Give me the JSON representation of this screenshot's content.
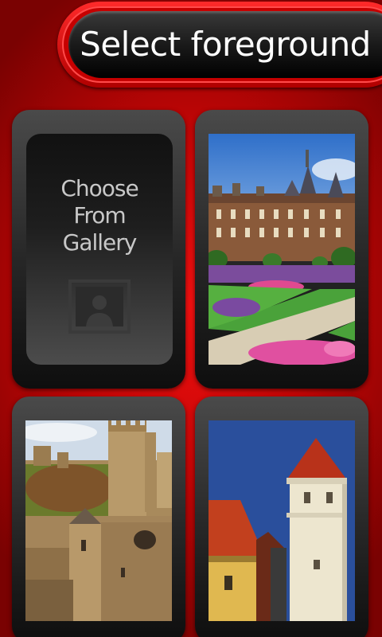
{
  "header": {
    "title": "Select foreground"
  },
  "gallery": {
    "label_line1": "Choose",
    "label_line2": "From",
    "label_line3": "Gallery",
    "icon": "person-picture-icon"
  },
  "thumbnails": [
    {
      "name": "manor-garden"
    },
    {
      "name": "castle-walls"
    },
    {
      "name": "tower-rooftops"
    }
  ],
  "colors": {
    "background": "#c80606",
    "header_bg": "#1a1a1a",
    "header_ring": "#ff2a2a",
    "card_bg": "#262626",
    "gallery_text": "#c8c8c8"
  }
}
